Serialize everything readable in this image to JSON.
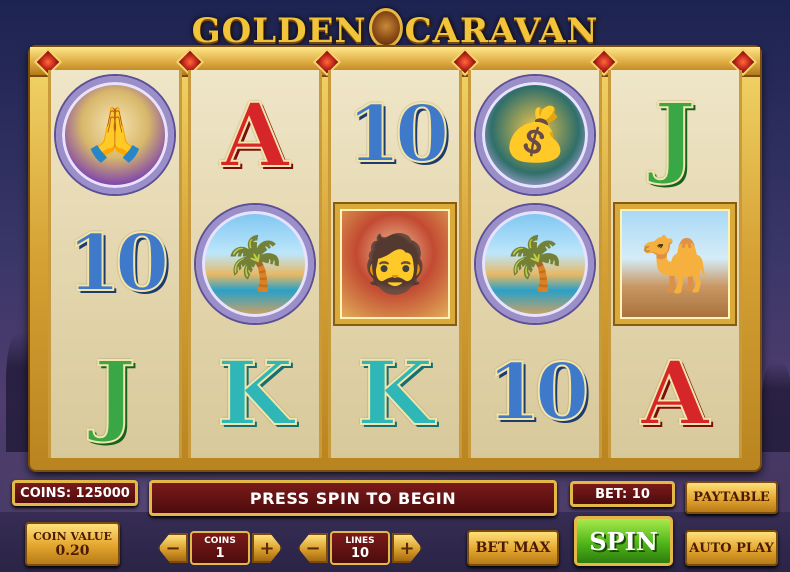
{
  "game": {
    "title_left": "GOLDEN",
    "title_right": "CARAVAN"
  },
  "reels": [
    [
      "merchant",
      "10",
      "J"
    ],
    [
      "A",
      "oasis",
      "K"
    ],
    [
      "10",
      "trader",
      "K"
    ],
    [
      "treasure-chest",
      "oasis",
      "10"
    ],
    [
      "J",
      "camel",
      "A"
    ]
  ],
  "status": {
    "coins_label": "COINS: 125000",
    "message": "PRESS SPIN TO BEGIN",
    "bet_label": "BET: 10"
  },
  "controls": {
    "paytable": "PAYTABLE",
    "spin": "SPIN",
    "bet_max": "BET MAX",
    "auto_play": "AUTO PLAY",
    "coin_value_label": "COIN VALUE",
    "coin_value": "0.20",
    "coins_stepper_label": "COINS",
    "coins_stepper_value": "1",
    "lines_stepper_label": "LINES",
    "lines_stepper_value": "10"
  },
  "colors": {
    "frame_gold": "#d5a134",
    "panel_red": "#7b1a1a",
    "spin_green": "#4fb61a"
  }
}
